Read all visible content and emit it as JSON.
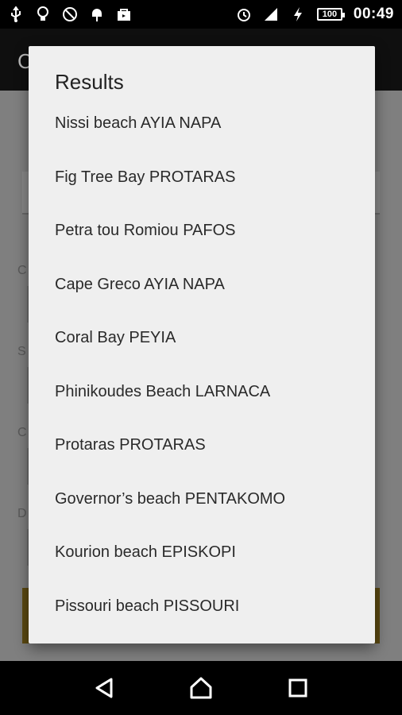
{
  "status_bar": {
    "left_icons": [
      "usb-icon",
      "lightbulb-icon",
      "no-camera-icon",
      "android-icon",
      "shopping-bag-icon"
    ],
    "right_icons": [
      "alarm-icon",
      "signal-icon",
      "charging-icon"
    ],
    "battery_level": "100",
    "time": "00:49"
  },
  "dialog": {
    "title": "Results",
    "items": [
      {
        "label": "Nissi beach AYIA NAPA"
      },
      {
        "label": "Fig Tree Bay PROTARAS"
      },
      {
        "label": "Petra tou Romiou PAFOS"
      },
      {
        "label": "Cape Greco AYIA NAPA"
      },
      {
        "label": "Coral Bay PEYIA"
      },
      {
        "label": "Phinikoudes Beach LARNACA"
      },
      {
        "label": "Protaras PROTARAS"
      },
      {
        "label": "Governor’s beach PENTAKOMO"
      },
      {
        "label": "Kourion beach EPISKOPI"
      },
      {
        "label": "Pissouri beach PISSOURI"
      }
    ]
  },
  "nav_bar": {
    "buttons": [
      "back-icon",
      "home-icon",
      "recents-icon"
    ]
  }
}
